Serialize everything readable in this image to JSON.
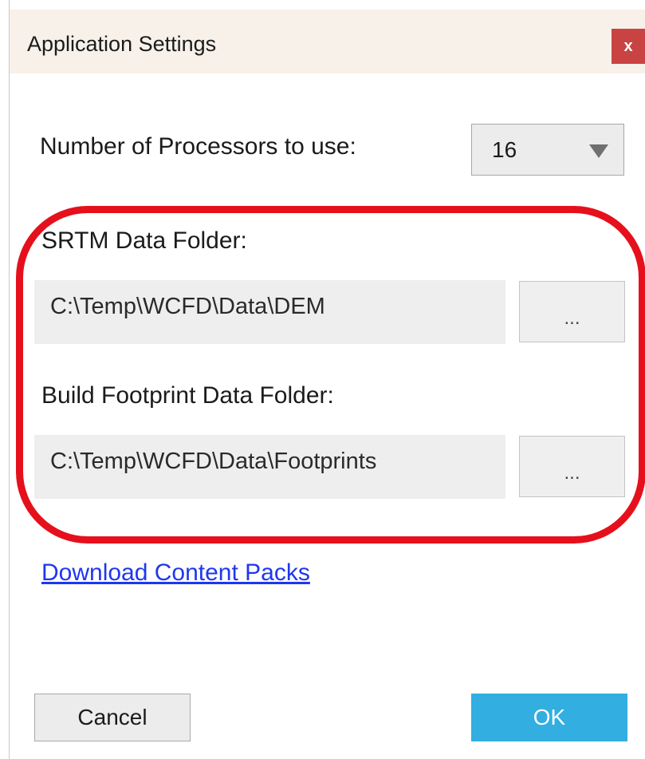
{
  "window": {
    "title": "Application Settings",
    "close_label": "x"
  },
  "processors": {
    "label": "Number of Processors to use:",
    "selected_value": "16"
  },
  "srtm": {
    "label": "SRTM Data Folder:",
    "path": "C:\\Temp\\WCFD\\Data\\DEM",
    "browse_label": "..."
  },
  "footprint": {
    "label": "Build Footprint Data Folder:",
    "path": "C:\\Temp\\WCFD\\Data\\Footprints",
    "browse_label": "..."
  },
  "download_link": "Download Content Packs",
  "buttons": {
    "cancel": "Cancel",
    "ok": "OK"
  },
  "colors": {
    "accent": "#32aee0",
    "close": "#c94343",
    "highlight": "#e5101c",
    "link": "#1f37f0"
  }
}
